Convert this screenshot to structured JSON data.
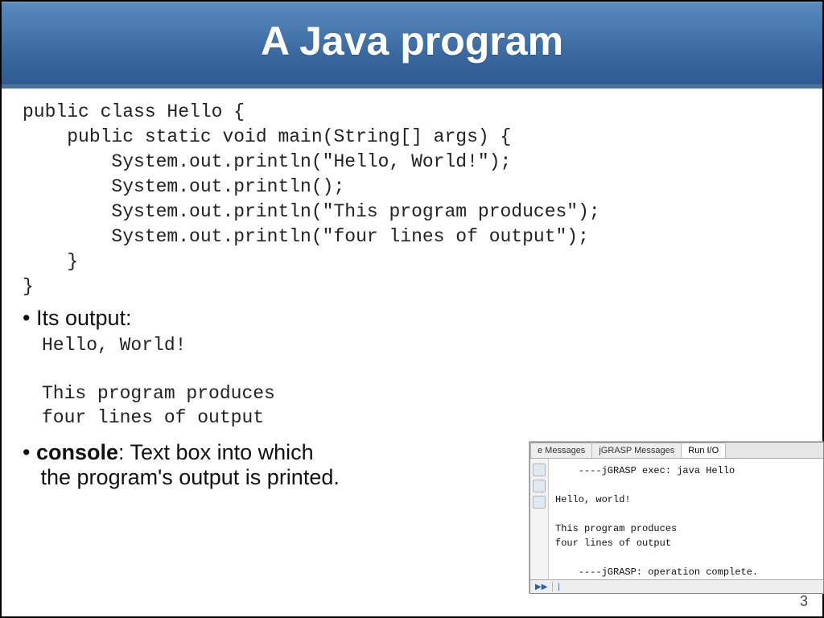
{
  "title": "A Java program",
  "code": "public class Hello {\n    public static void main(String[] args) {\n        System.out.println(\"Hello, World!\");\n        System.out.println();\n        System.out.println(\"This program produces\");\n        System.out.println(\"four lines of output\");\n    }\n}",
  "bullet_output": "Its output:",
  "output": "Hello, World!\n\nThis program produces\nfour lines of output",
  "console_term": "console",
  "console_def": ": Text box into which\n   the program's output is printed.",
  "page_num": "3",
  "jgrasp": {
    "tabs": [
      "e Messages",
      "jGRASP Messages",
      "Run I/O"
    ],
    "active_tab": 2,
    "lines": [
      "    ----jGRASP exec: java Hello",
      "",
      "Hello, world!",
      "",
      "This program produces",
      "four lines of output",
      "",
      "    ----jGRASP: operation complete."
    ],
    "toolbar": [
      "▶▶",
      "|"
    ]
  }
}
